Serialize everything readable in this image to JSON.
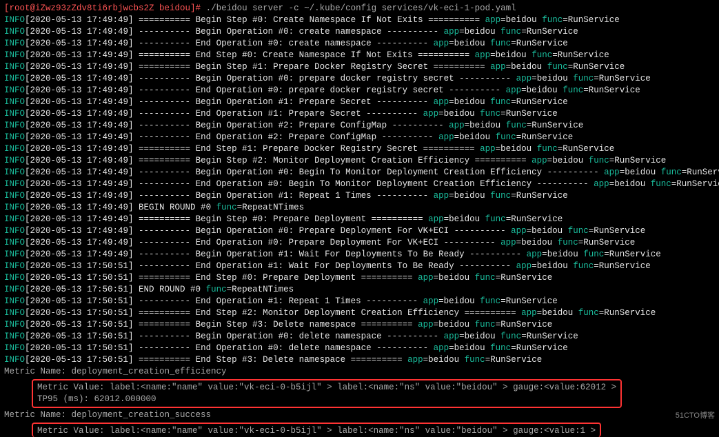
{
  "prompt": {
    "user_host": "[root@iZwz93zZdv8ti6rbjwcbs2Z beidou]# ",
    "command": "./beidou server -c ~/.kube/config services/vk-eci-1-pod.yaml"
  },
  "lines": [
    {
      "level": "INFO",
      "ts": "[2020-05-13 17:49:49]",
      "prefix": "==========",
      "msg": " Begin Step #0: Create Namespace If Not Exits ",
      "suffix": "==========",
      "app": "beidou",
      "func": "RunService"
    },
    {
      "level": "INFO",
      "ts": "[2020-05-13 17:49:49]",
      "prefix": "----------",
      "msg": " Begin Operation #0: create namespace ",
      "suffix": "----------",
      "app": "beidou",
      "func": "RunService"
    },
    {
      "level": "INFO",
      "ts": "[2020-05-13 17:49:49]",
      "prefix": "----------",
      "msg": " End Operation #0: create namespace ",
      "suffix": "----------",
      "app": "beidou",
      "func": "RunService"
    },
    {
      "level": "INFO",
      "ts": "[2020-05-13 17:49:49]",
      "prefix": "==========",
      "msg": " End Step #0: Create Namespace If Not Exits ",
      "suffix": "==========",
      "app": "beidou",
      "func": "RunService"
    },
    {
      "level": "INFO",
      "ts": "[2020-05-13 17:49:49]",
      "prefix": "==========",
      "msg": " Begin Step #1: Prepare Docker Registry Secret ",
      "suffix": "==========",
      "app": "beidou",
      "func": "RunService"
    },
    {
      "level": "INFO",
      "ts": "[2020-05-13 17:49:49]",
      "prefix": "----------",
      "msg": " Begin Operation #0: prepare docker registry secret ",
      "suffix": "----------",
      "app": "beidou",
      "func": "RunService"
    },
    {
      "level": "INFO",
      "ts": "[2020-05-13 17:49:49]",
      "prefix": "----------",
      "msg": " End Operation #0: prepare docker registry secret ",
      "suffix": "----------",
      "app": "beidou",
      "func": "RunService"
    },
    {
      "level": "INFO",
      "ts": "[2020-05-13 17:49:49]",
      "prefix": "----------",
      "msg": " Begin Operation #1: Prepare Secret ",
      "suffix": "----------",
      "app": "beidou",
      "func": "RunService"
    },
    {
      "level": "INFO",
      "ts": "[2020-05-13 17:49:49]",
      "prefix": "----------",
      "msg": " End Operation #1: Prepare Secret ",
      "suffix": "----------",
      "app": "beidou",
      "func": "RunService"
    },
    {
      "level": "INFO",
      "ts": "[2020-05-13 17:49:49]",
      "prefix": "----------",
      "msg": " Begin Operation #2: Prepare ConfigMap ",
      "suffix": "----------",
      "app": "beidou",
      "func": "RunService"
    },
    {
      "level": "INFO",
      "ts": "[2020-05-13 17:49:49]",
      "prefix": "----------",
      "msg": " End Operation #2: Prepare ConfigMap ",
      "suffix": "----------",
      "app": "beidou",
      "func": "RunService"
    },
    {
      "level": "INFO",
      "ts": "[2020-05-13 17:49:49]",
      "prefix": "==========",
      "msg": " End Step #1: Prepare Docker Registry Secret ",
      "suffix": "==========",
      "app": "beidou",
      "func": "RunService"
    },
    {
      "level": "INFO",
      "ts": "[2020-05-13 17:49:49]",
      "prefix": "==========",
      "msg": " Begin Step #2: Monitor Deployment Creation Efficiency ",
      "suffix": "==========",
      "app": "beidou",
      "func": "RunService"
    },
    {
      "level": "INFO",
      "ts": "[2020-05-13 17:49:49]",
      "prefix": "----------",
      "msg": " Begin Operation #0: Begin To Monitor Deployment Creation Efficiency ",
      "suffix": "----------",
      "app": "beidou",
      "func": "RunService"
    },
    {
      "level": "INFO",
      "ts": "[2020-05-13 17:49:49]",
      "prefix": "----------",
      "msg": " End Operation #0: Begin To Monitor Deployment Creation Efficiency ",
      "suffix": "----------",
      "app": "beidou",
      "func": "RunService"
    },
    {
      "level": "INFO",
      "ts": "[2020-05-13 17:49:49]",
      "prefix": "----------",
      "msg": " Begin Operation #1: Repeat 1 Times ",
      "suffix": "----------",
      "app": "beidou",
      "func": "RunService"
    },
    {
      "level": "INFO",
      "ts": "[2020-05-13 17:49:49]",
      "raw": " BEGIN ROUND #0                               ",
      "funcOnly": "RepeatNTimes"
    },
    {
      "level": "INFO",
      "ts": "[2020-05-13 17:49:49]",
      "prefix": "==========",
      "msg": " Begin Step #0: Prepare Deployment ",
      "suffix": "==========",
      "app": "beidou",
      "func": "RunService"
    },
    {
      "level": "INFO",
      "ts": "[2020-05-13 17:49:49]",
      "prefix": "----------",
      "msg": " Begin Operation #0: Prepare Deployment For VK+ECI ",
      "suffix": "----------",
      "app": "beidou",
      "func": "RunService"
    },
    {
      "level": "INFO",
      "ts": "[2020-05-13 17:49:49]",
      "prefix": "----------",
      "msg": " End Operation #0: Prepare Deployment For VK+ECI ",
      "suffix": "----------",
      "app": "beidou",
      "func": "RunService"
    },
    {
      "level": "INFO",
      "ts": "[2020-05-13 17:49:49]",
      "prefix": "----------",
      "msg": " Begin Operation #1: Wait For Deployments To Be Ready ",
      "suffix": "----------",
      "app": "beidou",
      "func": "RunService"
    },
    {
      "level": "INFO",
      "ts": "[2020-05-13 17:50:51]",
      "prefix": "----------",
      "msg": " End Operation #1: Wait For Deployments To Be Ready ",
      "suffix": "----------",
      "app": "beidou",
      "func": "RunService"
    },
    {
      "level": "INFO",
      "ts": "[2020-05-13 17:50:51]",
      "prefix": "==========",
      "msg": " End Step #0: Prepare Deployment ",
      "suffix": "==========",
      "app": "beidou",
      "func": "RunService"
    },
    {
      "level": "INFO",
      "ts": "[2020-05-13 17:50:51]",
      "raw": " END ROUND #0                                 ",
      "funcOnly": "RepeatNTimes"
    },
    {
      "level": "INFO",
      "ts": "[2020-05-13 17:50:51]",
      "prefix": "----------",
      "msg": " End Operation #1: Repeat 1 Times ",
      "suffix": "----------",
      "app": "beidou",
      "func": "RunService"
    },
    {
      "level": "INFO",
      "ts": "[2020-05-13 17:50:51]",
      "prefix": "==========",
      "msg": " End Step #2: Monitor Deployment Creation Efficiency ",
      "suffix": "==========",
      "app": "beidou",
      "func": "RunService"
    },
    {
      "level": "INFO",
      "ts": "[2020-05-13 17:50:51]",
      "prefix": "==========",
      "msg": " Begin Step #3: Delete namespace ",
      "suffix": "==========",
      "app": "beidou",
      "func": "RunService"
    },
    {
      "level": "INFO",
      "ts": "[2020-05-13 17:50:51]",
      "prefix": "----------",
      "msg": " Begin Operation #0: delete namespace ",
      "suffix": "----------",
      "app": "beidou",
      "func": "RunService"
    },
    {
      "level": "INFO",
      "ts": "[2020-05-13 17:50:51]",
      "prefix": "----------",
      "msg": " End Operation #0: delete namespace ",
      "suffix": "----------",
      "app": "beidou",
      "func": "RunService"
    },
    {
      "level": "INFO",
      "ts": "[2020-05-13 17:50:51]",
      "prefix": "==========",
      "msg": " End Step #3: Delete namespace ",
      "suffix": "==========",
      "app": "beidou",
      "func": "RunService"
    }
  ],
  "metrics": {
    "name1": "Metric Name: deployment_creation_efficiency",
    "box1_line1": "Metric Value: label:<name:\"name\" value:\"vk-eci-0-b5ijl\" > label:<name:\"ns\" value:\"beidou\" > gauge:<value:62012 >",
    "box1_line2": "TP95 (ms): 62012.000000",
    "name2": "Metric Name: deployment_creation_success",
    "box2_line1": "Metric Value: label:<name:\"name\" value:\"vk-eci-0-b5ijl\" > label:<name:\"ns\" value:\"beidou\" > gauge:<value:1 >"
  },
  "watermark": "51CTO博客",
  "keys": {
    "app": "app",
    "func": "func"
  }
}
